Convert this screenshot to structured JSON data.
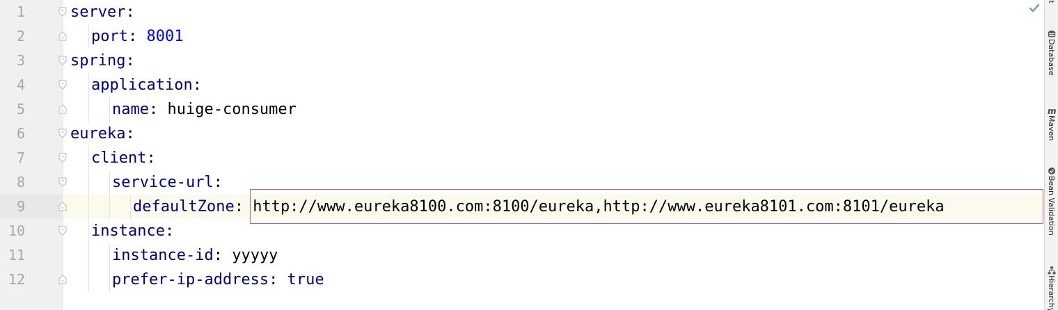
{
  "editor": {
    "caret_line": 9,
    "colors": {
      "key": "#000080",
      "number": "#0000ff",
      "keyword": "#000080",
      "text": "#000000",
      "line_number": "#a8a8a8",
      "caret_line_bg": "#fcfaed",
      "highlight_border": "#e0546a"
    },
    "lines": [
      {
        "number": "1",
        "indent": 0,
        "key": "server",
        "value": "",
        "value_type": "",
        "fold": "open"
      },
      {
        "number": "2",
        "indent": 1,
        "key": "port",
        "value": "8001",
        "value_type": "number",
        "fold": "end"
      },
      {
        "number": "3",
        "indent": 0,
        "key": "spring",
        "value": "",
        "value_type": "",
        "fold": "open"
      },
      {
        "number": "4",
        "indent": 1,
        "key": "application",
        "value": "",
        "value_type": "",
        "fold": "open"
      },
      {
        "number": "5",
        "indent": 2,
        "key": "name",
        "value": "huige-consumer",
        "value_type": "string",
        "fold": "end"
      },
      {
        "number": "6",
        "indent": 0,
        "key": "eureka",
        "value": "",
        "value_type": "",
        "fold": "open"
      },
      {
        "number": "7",
        "indent": 1,
        "key": "client",
        "value": "",
        "value_type": "",
        "fold": "open"
      },
      {
        "number": "8",
        "indent": 2,
        "key": "service-url",
        "value": "",
        "value_type": "",
        "fold": "open"
      },
      {
        "number": "9",
        "indent": 3,
        "key": "defaultZone",
        "value": "http://www.eureka8100.com:8100/eureka,http://www.eureka8101.com:8101/eureka",
        "value_type": "string",
        "fold": "end"
      },
      {
        "number": "10",
        "indent": 1,
        "key": "instance",
        "value": "",
        "value_type": "",
        "fold": "open"
      },
      {
        "number": "11",
        "indent": 2,
        "key": "instance-id",
        "value": "yyyyy",
        "value_type": "string",
        "fold": "none"
      },
      {
        "number": "12",
        "indent": 2,
        "key": "prefer-ip-address",
        "value": "true",
        "value_type": "keyword",
        "fold": "end"
      }
    ]
  },
  "status": {
    "icon": "check-icon",
    "color": "#59a869"
  },
  "right_panel": {
    "tabs": [
      {
        "id": "ant",
        "label": "Ant",
        "icon": "ant-icon"
      },
      {
        "id": "database",
        "label": "Database",
        "icon": "database-icon"
      },
      {
        "id": "maven",
        "label": "Maven",
        "icon": "maven-icon"
      },
      {
        "id": "bean-validation",
        "label": "Bean Validation",
        "icon": "bean-validation-icon"
      },
      {
        "id": "hierarchy",
        "label": "Hierarchy",
        "icon": "hierarchy-icon"
      }
    ]
  }
}
